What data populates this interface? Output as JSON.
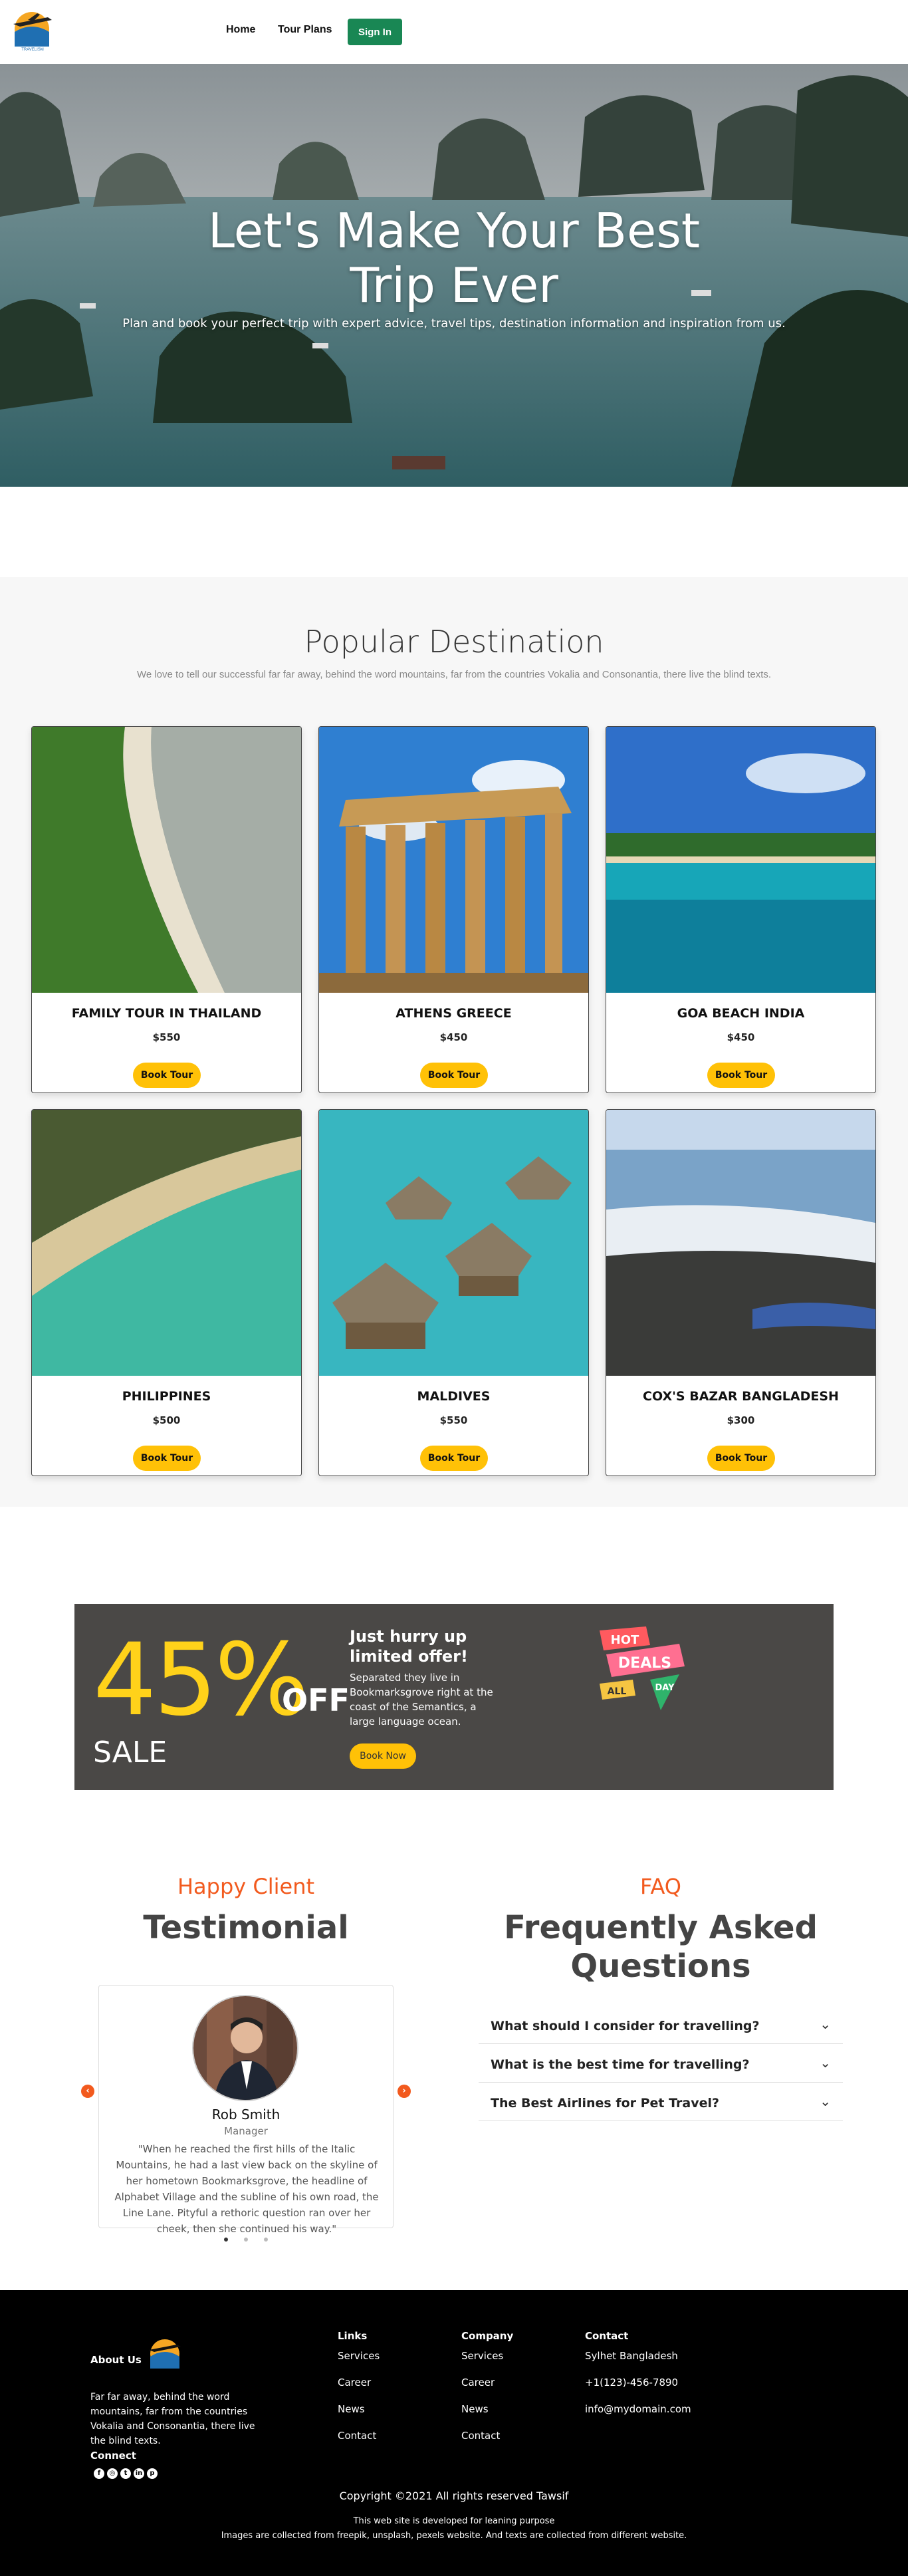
{
  "nav": {
    "logo_text": "TRAVELISM",
    "links": [
      "Home",
      "Tour Plans"
    ],
    "signin_label": "Sign In",
    "signin_color": "#198754"
  },
  "hero": {
    "title_line1": "Let's Make Your Best",
    "title_line2": "Trip Ever",
    "subtitle": "Plan and book your perfect trip with expert advice, travel tips, destination information and inspiration from us."
  },
  "destinations": {
    "title": "Popular Destination",
    "subtitle": "We love to tell our successful far far away, behind the word mountains, far from the countries Vokalia and Consonantia, there live the blind texts.",
    "items": [
      {
        "name": "FAMILY TOUR IN THAILAND",
        "price": "$550",
        "button": "Book Tour",
        "image": "aerial-beach-forest-image"
      },
      {
        "name": "ATHENS GREECE",
        "price": "$450",
        "button": "Book Tour",
        "image": "parthenon-image"
      },
      {
        "name": "GOA BEACH INDIA",
        "price": "$450",
        "button": "Book Tour",
        "image": "goa-beach-image"
      },
      {
        "name": "PHILIPPINES",
        "price": "$500",
        "button": "Book Tour",
        "image": "palm-beach-aerial-image"
      },
      {
        "name": "MALDIVES",
        "price": "$550",
        "button": "Book Tour",
        "image": "water-villas-image"
      },
      {
        "name": "COX'S BAZAR BANGLADESH",
        "price": "$300",
        "button": "Book Tour",
        "image": "coxs-bazar-shore-image"
      }
    ],
    "button_color": "#ffc107"
  },
  "deal": {
    "percent": "45%",
    "off": "OFF",
    "sale": "SALE",
    "heading": "Just hurry up limited offer!",
    "text": "Separated they live in Bookmarksgrove right at the coast of the Semantics, a large language ocean.",
    "button": "Book Now",
    "badge": {
      "hot": "HOT",
      "deals": "DEALS",
      "all": "ALL",
      "day": "DAY"
    },
    "accent": "#ffd21a"
  },
  "testimonial": {
    "eyebrow": "Happy Client",
    "heading": "Testimonial",
    "name": "Rob Smith",
    "role": "Manager",
    "quote": "\"When he reached the first hills of the Italic Mountains, he had a last view back on the skyline of her hometown Bookmarksgrove, the headline of Alphabet Village and the subline of his own road, the Line Lane. Pityful a rethoric question ran over her cheek, then she continued his way.\"",
    "accent": "#f25a1e"
  },
  "faq": {
    "eyebrow": "FAQ",
    "heading_line1": "Frequently Asked",
    "heading_line2": "Questions",
    "questions": [
      "What should I consider for travelling?",
      "What is the best time for travelling?",
      "The Best Airlines for Pet Travel?"
    ]
  },
  "footer": {
    "about_heading": "About Us",
    "about_text": "Far far away, behind the word mountains, far from the countries Vokalia and Consonantia, there live the blind texts.",
    "connect_heading": "Connect",
    "social_icons": [
      "facebook-icon",
      "instagram-icon",
      "twitter-icon",
      "linkedin-icon",
      "pinterest-icon"
    ],
    "links_heading": "Links",
    "links": [
      "Services",
      "Career",
      "News",
      "Contact"
    ],
    "company_heading": "Company",
    "company_links": [
      "Services",
      "Career",
      "News",
      "Contact"
    ],
    "contact_heading": "Contact",
    "contact": [
      "Sylhet Bangladesh",
      "+1(123)-456-7890",
      "info@mydomain.com"
    ],
    "copyright": "Copyright ©2021 All rights reserved Tawsif",
    "note1": "This web site is developed for leaning purpose",
    "note2": "Images are collected from freepik, unsplash, pexels website. And texts are collected from different website."
  }
}
